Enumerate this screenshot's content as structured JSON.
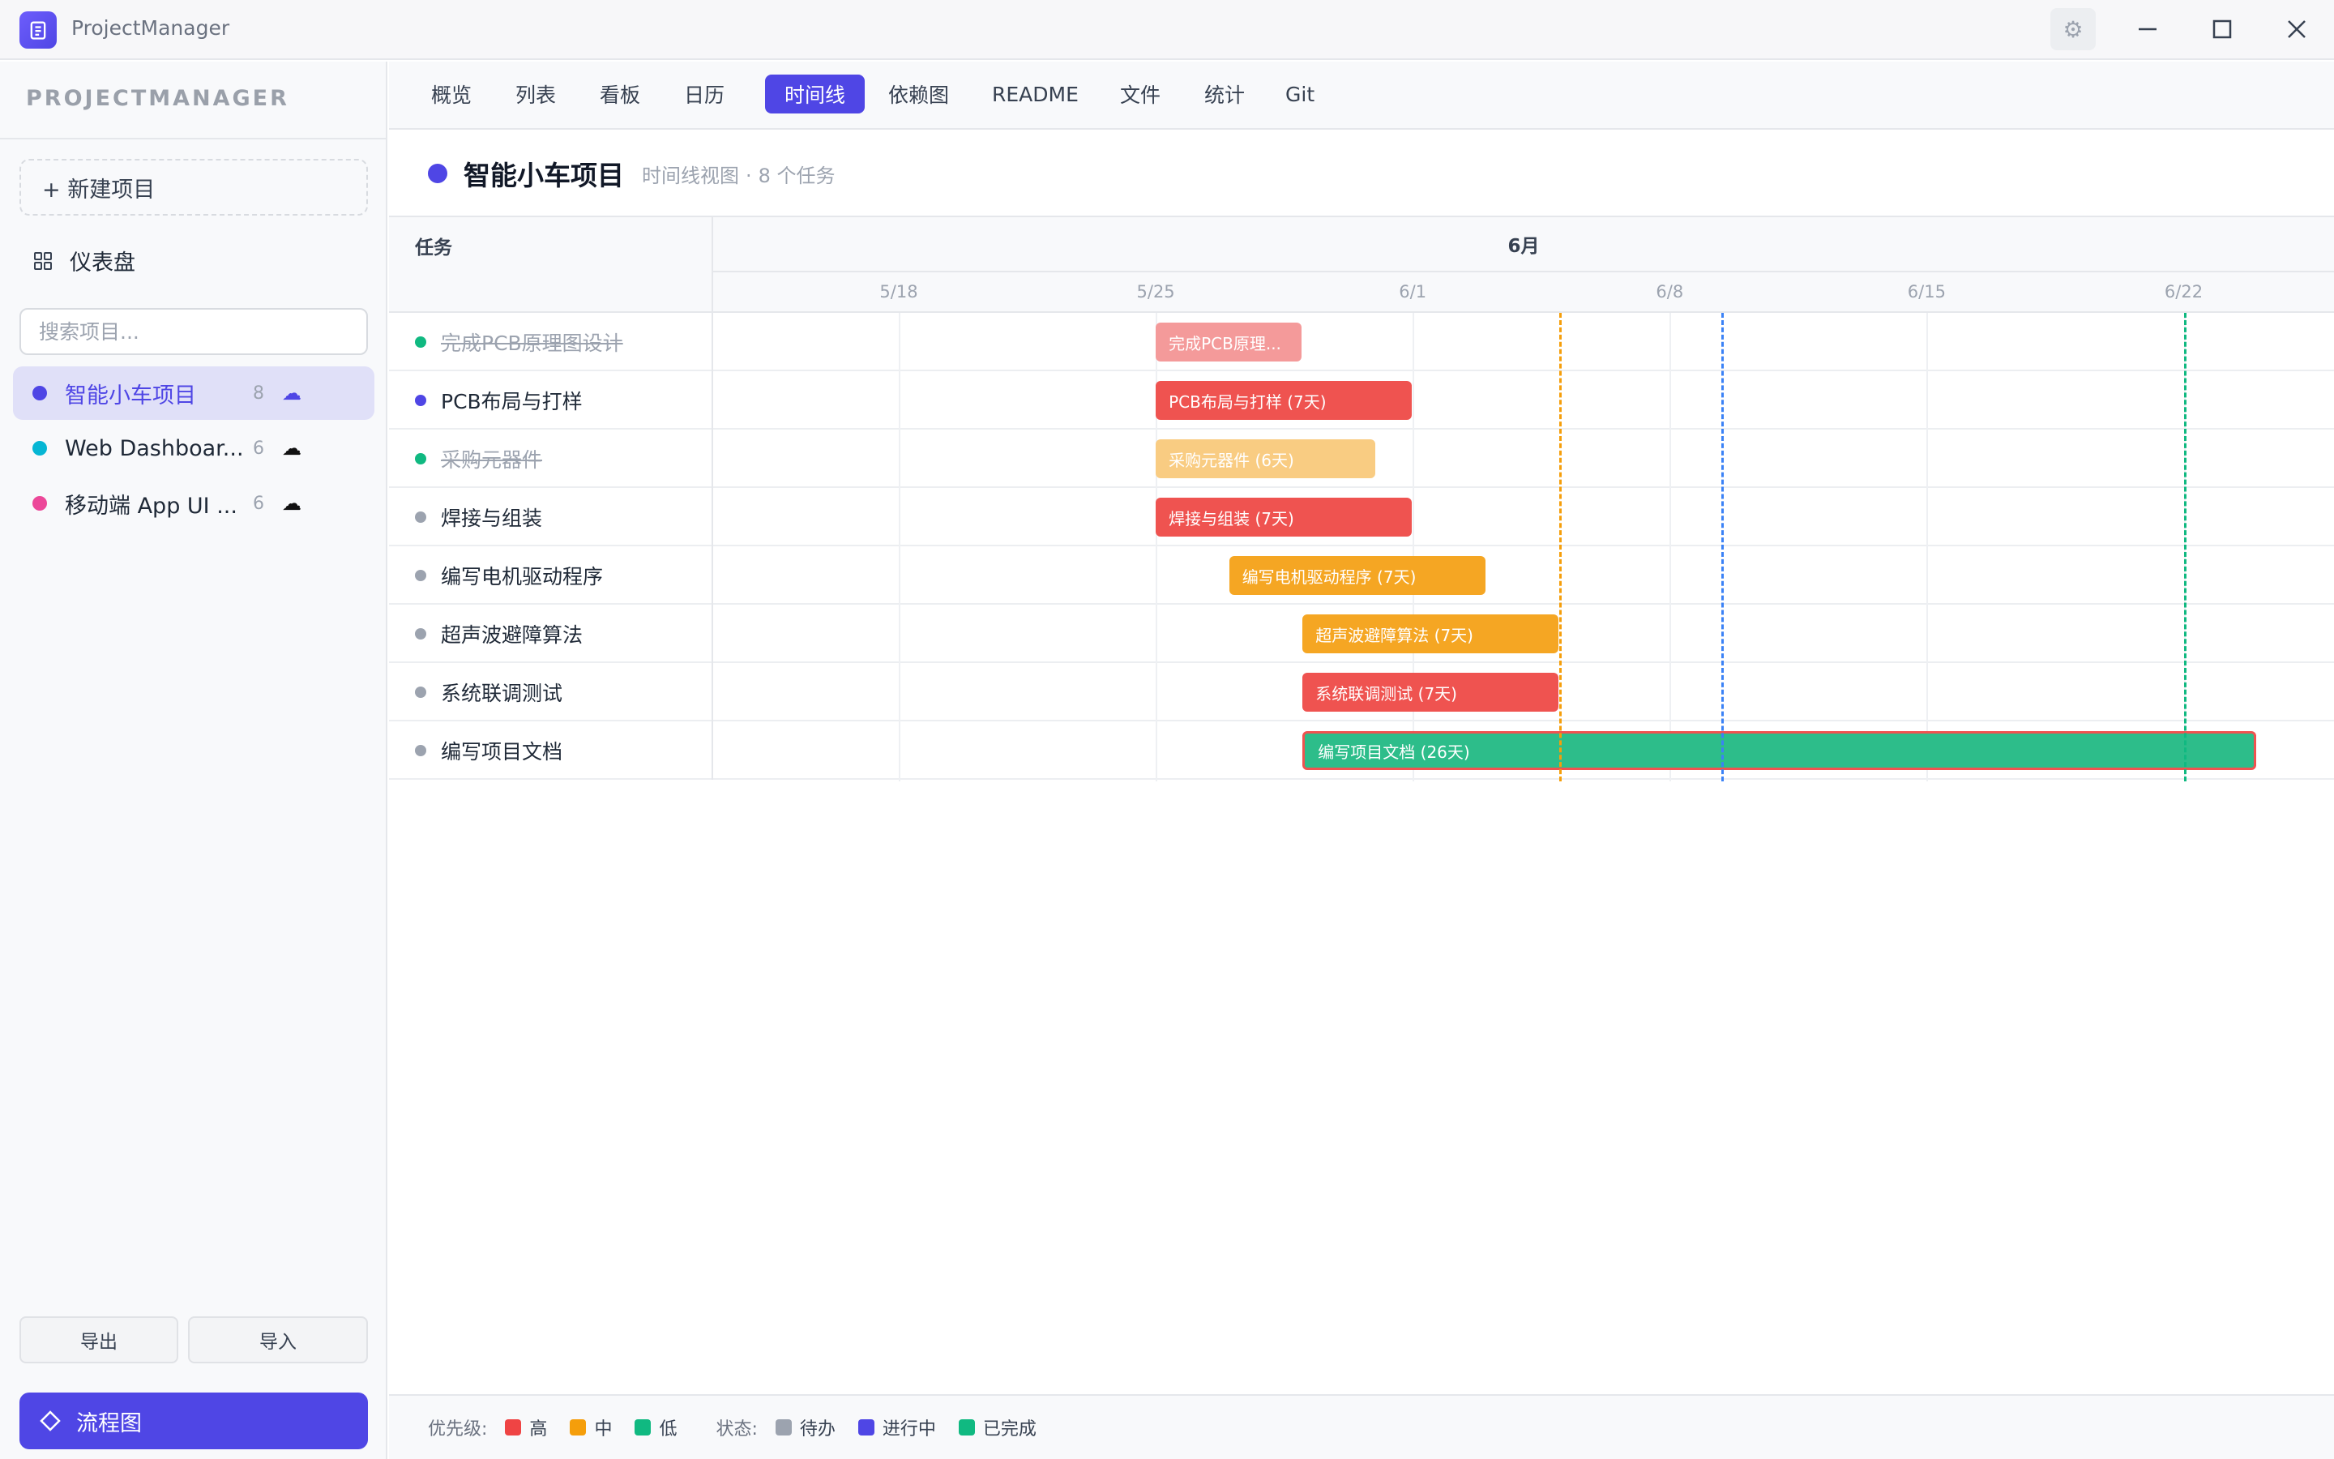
{
  "app": {
    "title": "ProjectManager",
    "brand": "PROJECTMANAGER"
  },
  "sidebar": {
    "new_project": "+ 新建项目",
    "dashboard": "仪表盘",
    "search_placeholder": "搜索项目...",
    "projects": [
      {
        "name": "智能小车项目",
        "count": "8",
        "color": "#4f46e5",
        "active": true
      },
      {
        "name": "Web Dashboar...",
        "count": "6",
        "color": "#06b6d4",
        "active": false
      },
      {
        "name": "移动端 App UI ...",
        "count": "6",
        "color": "#ec4899",
        "active": false
      }
    ],
    "export": "导出",
    "import": "导入",
    "flowchart": "流程图"
  },
  "tabs": [
    {
      "label": "概览"
    },
    {
      "label": "列表"
    },
    {
      "label": "看板"
    },
    {
      "label": "日历"
    },
    {
      "label": "时间线",
      "active": true
    },
    {
      "label": "依赖图"
    },
    {
      "label": "README"
    },
    {
      "label": "文件"
    },
    {
      "label": "统计"
    },
    {
      "label": "Git"
    }
  ],
  "header": {
    "title": "智能小车项目",
    "view_name": "时间线视图",
    "task_count": "8 个任务"
  },
  "gantt": {
    "task_column": "任务",
    "month": "6月",
    "days": [
      "5/18",
      "5/25",
      "6/1",
      "6/8",
      "6/15",
      "6/22"
    ],
    "tasks": [
      {
        "name": "完成PCB原理图设计",
        "bar_label": "完成PCB原理...",
        "status": "done",
        "priority": "high",
        "start": "5/25",
        "days": 4
      },
      {
        "name": "PCB布局与打样",
        "bar_label": "PCB布局与打样 (7天)",
        "status": "todo-progress",
        "priority": "high",
        "start": "5/25",
        "days": 7
      },
      {
        "name": "采购元器件",
        "bar_label": "采购元器件 (6天)",
        "status": "done",
        "priority": "medium",
        "start": "5/25",
        "days": 6
      },
      {
        "name": "焊接与组装",
        "bar_label": "焊接与组装 (7天)",
        "status": "todo",
        "priority": "high",
        "start": "5/25",
        "days": 7
      },
      {
        "name": "编写电机驱动程序",
        "bar_label": "编写电机驱动程序 (7天)",
        "status": "todo",
        "priority": "medium",
        "start": "5/27",
        "days": 7
      },
      {
        "name": "超声波避障算法",
        "bar_label": "超声波避障算法 (7天)",
        "status": "todo",
        "priority": "medium",
        "start": "5/29",
        "days": 7
      },
      {
        "name": "系统联调测试",
        "bar_label": "系统联调测试 (7天)",
        "status": "todo",
        "priority": "high",
        "start": "5/29",
        "days": 7
      },
      {
        "name": "编写项目文档",
        "bar_label": "编写项目文档 (26天)",
        "status": "todo",
        "priority": "low",
        "start": "5/29",
        "days": 26
      }
    ]
  },
  "legend": {
    "priority_label": "优先级:",
    "high": "高",
    "medium": "中",
    "low": "低",
    "status_label": "状态:",
    "todo": "待办",
    "in_progress": "进行中",
    "done": "已完成"
  },
  "colors": {
    "accent": "#4f46e5",
    "high": "#ef5350",
    "medium": "#f5a623",
    "low": "#10b981",
    "todo": "#9ca3af",
    "in_progress": "#4f46e5",
    "done": "#10b981"
  }
}
